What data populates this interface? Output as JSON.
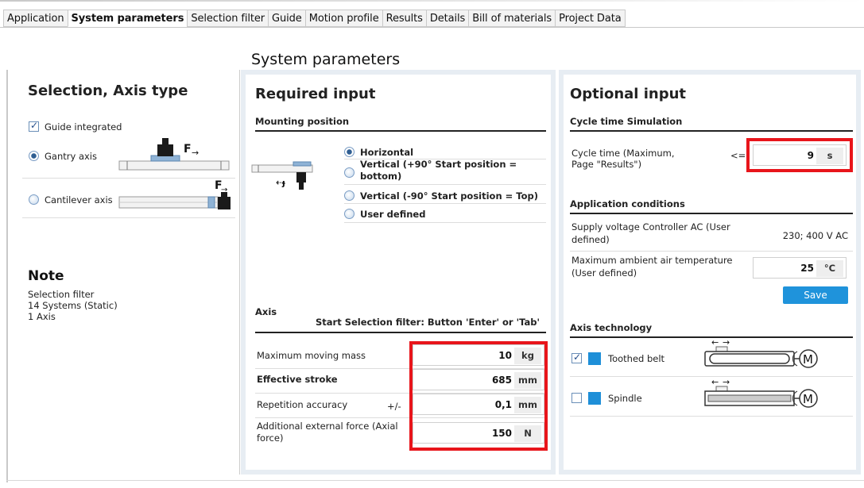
{
  "tabs": [
    {
      "label": "Application"
    },
    {
      "label": "System parameters"
    },
    {
      "label": "Selection filter"
    },
    {
      "label": "Guide"
    },
    {
      "label": "Motion profile"
    },
    {
      "label": "Results"
    },
    {
      "label": "Details"
    },
    {
      "label": "Bill of materials"
    },
    {
      "label": "Project Data"
    }
  ],
  "page_title": "System parameters",
  "left": {
    "title": "Selection, Axis type",
    "guide_integrated": "Guide integrated",
    "gantry_axis": "Gantry axis",
    "cantilever_axis": "Cantilever axis",
    "force_label": "F",
    "force_label2": "F",
    "note_title": "Note",
    "note_lines": [
      "Selection filter",
      "14 Systems (Static)",
      "1 Axis"
    ]
  },
  "required": {
    "title": "Required input",
    "mounting_position": "Mounting position",
    "options": [
      "Horizontal",
      "Vertical (+90° Start position = bottom)",
      "Vertical (-90° Start position = Top)",
      "User defined"
    ],
    "axis_heading": "Axis",
    "axis_hint": "Start Selection filter: Button 'Enter' or 'Tab'",
    "fields": [
      {
        "label": "Maximum moving mass",
        "value": "10",
        "unit": "kg"
      },
      {
        "label": "Effective stroke",
        "value": "685",
        "unit": "mm"
      },
      {
        "label": "Repetition accuracy",
        "prefix": "+/-",
        "value": "0,1",
        "unit": "mm"
      },
      {
        "label": "Additional external force (Axial force)",
        "value": "150",
        "unit": "N"
      }
    ]
  },
  "optional": {
    "title": "Optional input",
    "cycle_heading": "Cycle time Simulation",
    "cycle_label": "Cycle time (Maximum, Page \"Results\")",
    "cycle_op": "<=",
    "cycle_value": "9",
    "cycle_unit": "s",
    "app_heading": "Application conditions",
    "supply_label": "Supply voltage Controller AC (User defined)",
    "supply_value": "230; 400 V AC",
    "temp_label": "Maximum ambient air temperature (User defined)",
    "temp_value": "25",
    "temp_unit": "°C",
    "save_label": "Save",
    "axis_tech_heading": "Axis technology",
    "tech": [
      {
        "label": "Toothed belt",
        "checked": true
      },
      {
        "label": "Spindle",
        "checked": false
      }
    ],
    "motor_label": "M"
  },
  "colors": {
    "accent": "#1f93db",
    "highlight": "#e8151b",
    "panel_border": "#e7edf3"
  }
}
